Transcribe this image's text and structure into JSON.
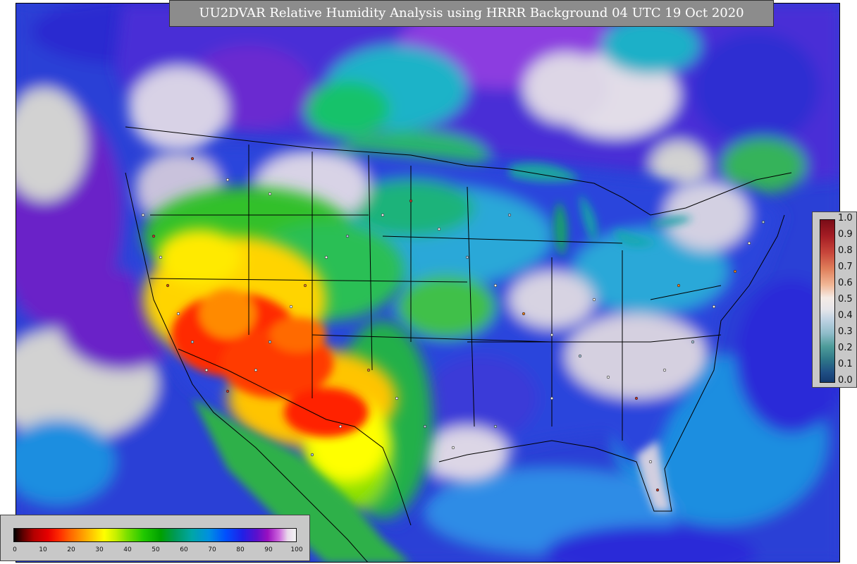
{
  "title": "UU2DVAR Relative Humidity Analysis using HRRR Background 04 UTC 19 Oct 2020",
  "station_legend": {
    "labels": [
      "1.0",
      "0.9",
      "0.8",
      "0.7",
      "0.6",
      "0.5",
      "0.4",
      "0.3",
      "0.2",
      "0.1",
      "0.0"
    ]
  },
  "rh_legend": {
    "labels": [
      "0",
      "10",
      "20",
      "30",
      "40",
      "50",
      "60",
      "70",
      "80",
      "90",
      "100"
    ]
  },
  "colors": {
    "ocean": "#2c3fd6",
    "very_dry": "#e60000",
    "dry": "#ffcc00",
    "moderate": "#00a000",
    "moist": "#0090e0",
    "very_moist": "#5a10cc",
    "saturated": "#d2d2d2"
  },
  "icons": {
    "observation_station": "station-dot-icon"
  }
}
